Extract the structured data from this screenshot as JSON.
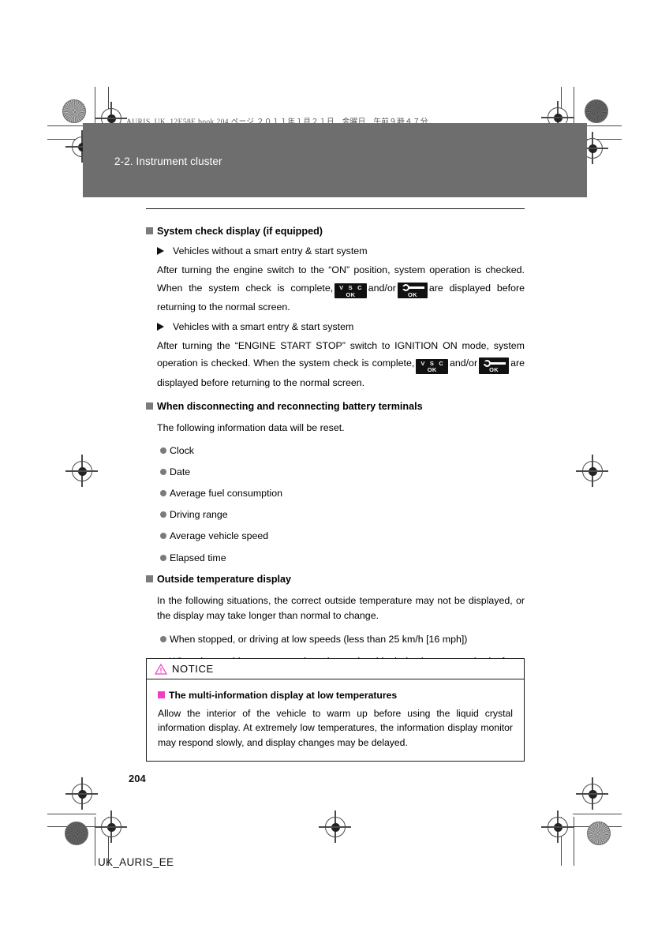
{
  "print_header": "AURIS_UK_12E58E.book  204 ページ  ２０１１年１月２１日　金曜日　午前９時４７分",
  "banner": {
    "chapter_title": "2-2. Instrument cluster",
    "bg_color": "#6e6e6e"
  },
  "sections": [
    {
      "heading": "System check display (if equipped)",
      "sub1": "Vehicles without a smart entry & start system",
      "para1_a": "After turning the engine switch to the “ON” position, system operation is checked. When the system check is complete,",
      "para1_b": "and/or",
      "para1_c": "are displayed before returning to the normal screen.",
      "sub2": "Vehicles with a smart entry & start system",
      "para2_a": "After turning the “ENGINE START STOP” switch to IGNITION ON mode, system operation is checked. When the system check is complete,",
      "para2_b": "and/or",
      "para2_c": "are displayed before returning to the normal screen."
    },
    {
      "heading": "When disconnecting and reconnecting battery terminals",
      "intro": "The following information data will be reset.",
      "items": [
        "Clock",
        "Date",
        "Average fuel consumption",
        "Driving range",
        "Average vehicle speed",
        "Elapsed time"
      ]
    },
    {
      "heading": "Outside temperature display",
      "intro": "In the following situations, the correct outside temperature may not be displayed, or the display may take longer than normal to change.",
      "items": [
        "When stopped, or driving at low speeds (less than 25 km/h [16 mph])",
        "When the outside temperature has changed suddenly (at the entrance/ exit of a garage, tunnel, etc.)"
      ]
    }
  ],
  "lcd_icons": {
    "vsc_line1": "V S C",
    "vsc_line2": "OK",
    "wrench_line2": "OK"
  },
  "notice": {
    "title": "NOTICE",
    "warning_color": "#ef3ec0",
    "subheading": "The multi-information display at low temperatures",
    "text": "Allow the interior of the vehicle to warm up before using the liquid crystal information display. At extremely low temperatures, the information display monitor may respond slowly, and display changes may be delayed."
  },
  "page_number": "204",
  "footer_code": "UK_AURIS_EE"
}
